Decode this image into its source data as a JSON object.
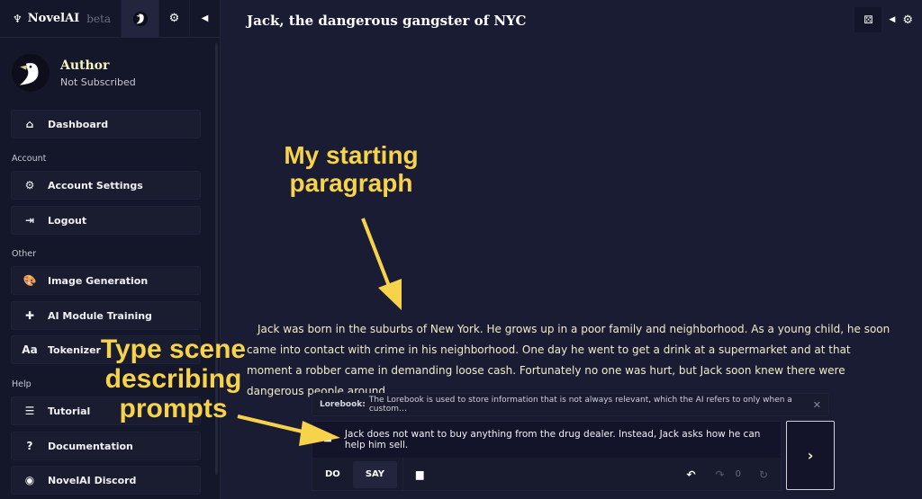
{
  "app": {
    "name": "NovelAI",
    "badge": "beta"
  },
  "profile": {
    "name": "Author",
    "status": "Not Subscribed"
  },
  "sidebar": {
    "dashboard": "Dashboard",
    "sections": {
      "account": "Account",
      "other": "Other",
      "help": "Help"
    },
    "account_items": [
      {
        "label": "Account Settings",
        "icon": "gear-icon"
      },
      {
        "label": "Logout",
        "icon": "logout-icon"
      }
    ],
    "other_items": [
      {
        "label": "Image Generation",
        "icon": "palette-icon"
      },
      {
        "label": "AI Module Training",
        "icon": "puzzle-icon"
      },
      {
        "label": "Tokenizer",
        "icon": "text-icon",
        "glyph": "Aa"
      }
    ],
    "help_items": [
      {
        "label": "Tutorial",
        "icon": "document-icon"
      },
      {
        "label": "Documentation",
        "icon": "question-icon",
        "glyph": "?"
      },
      {
        "label": "NovelAI Discord",
        "icon": "discord-icon"
      }
    ]
  },
  "story": {
    "title": "Jack, the dangerous gangster of NYC",
    "text": "Jack was born in the suburbs of New York. He grows up in a poor family and neighborhood. As a young child, he soon came into contact with crime in his neighborhood. One day he went to get a drink at a supermarket and at that moment a robber came in demanding loose cash. Fortunately no one was hurt, but Jack soon knew there were dangerous people around."
  },
  "lorebook": {
    "label": "Lorebook:",
    "text": "The Lorebook is used to store information that is not always relevant, which the AI refers to only when a custom…",
    "close": "✕"
  },
  "input": {
    "value": "Jack does not want to buy anything from the drug dealer. Instead, Jack asks how he can help him sell.",
    "modes": [
      "DO",
      "SAY"
    ],
    "active_mode": "SAY",
    "retry_count": "0",
    "send": "›"
  },
  "annotations": {
    "top": "My starting paragraph",
    "left": "Type scene describing prompts"
  },
  "colors": {
    "accent": "#f5f3c2",
    "annotation": "#f6d34a",
    "background": "#1a1c33"
  }
}
